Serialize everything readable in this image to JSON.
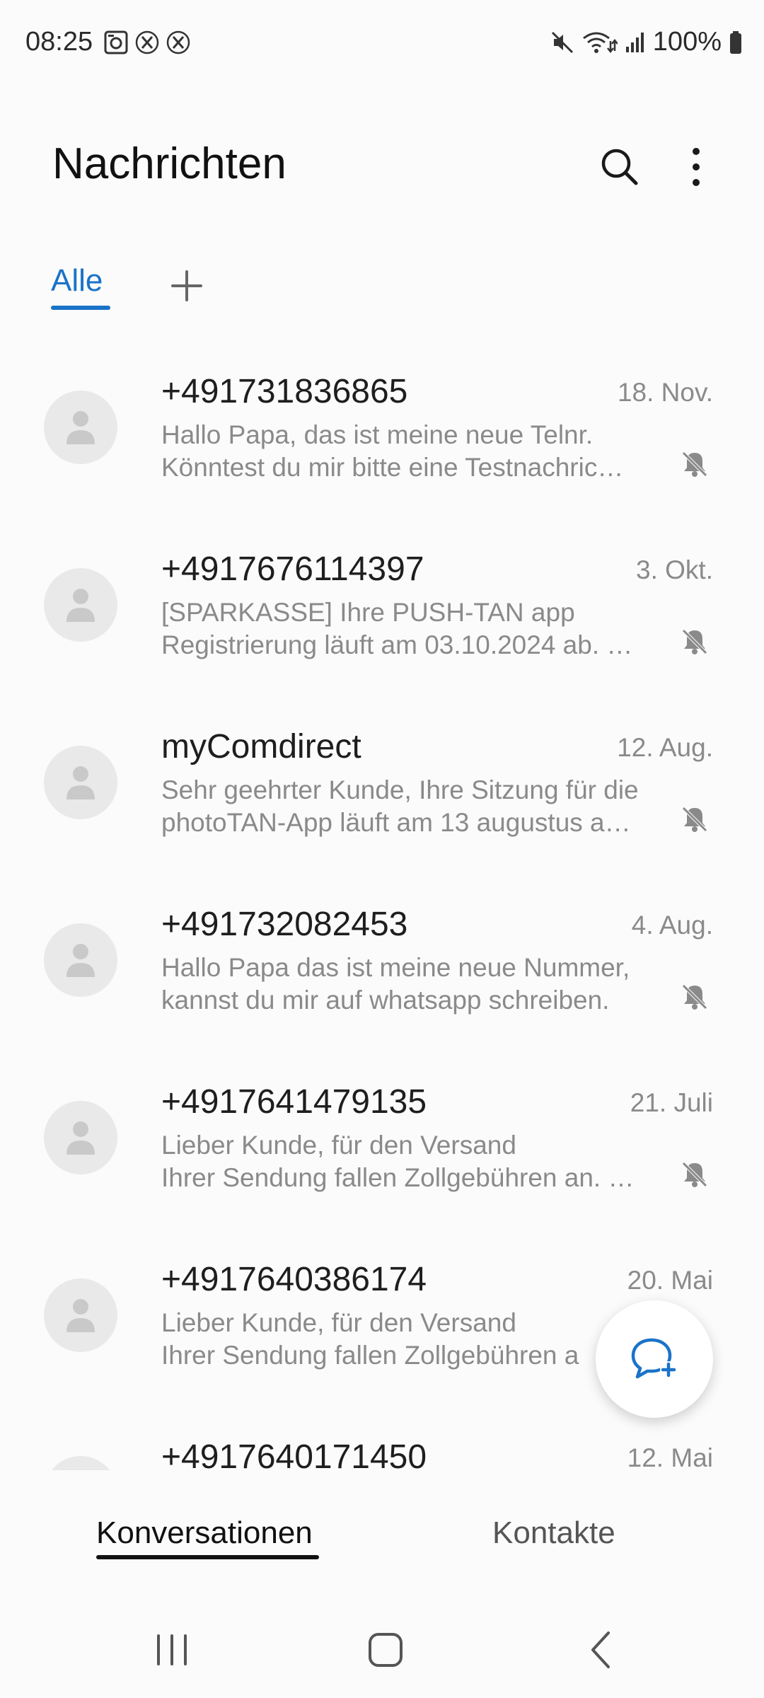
{
  "status_bar": {
    "time": "08:25",
    "left_icons": [
      "gallery-notification-icon",
      "x-notification-icon",
      "x-notification-icon"
    ],
    "right_icons": [
      "mute-icon",
      "wifi-icon",
      "signal-icon",
      "battery-icon"
    ],
    "battery": "100%"
  },
  "header": {
    "title": "Nachrichten",
    "search_icon": "search-icon",
    "more_icon": "more-vertical-icon"
  },
  "categories": {
    "active_label": "Alle",
    "add_icon": "plus-icon",
    "accent_color": "#1a73c8"
  },
  "conversations": [
    {
      "name": "+491731836865",
      "date": "18. Nov.",
      "line1": "Hallo Papa, das ist meine neue Telnr.",
      "line2": "Könntest du mir bitte eine Testnachric…",
      "muted": true
    },
    {
      "name": "+4917676114397",
      "date": "3. Okt.",
      "line1": "[SPARKASSE]  Ihre PUSH-TAN app",
      "line2": "Registrierung läuft am 03.10.2024 ab. …",
      "muted": true
    },
    {
      "name": "myComdirect",
      "date": "12. Aug.",
      "line1": "Sehr geehrter Kunde, Ihre Sitzung für die",
      "line2": "photoTAN-App läuft am 13 augustus a…",
      "muted": true
    },
    {
      "name": "+491732082453",
      "date": "4. Aug.",
      "line1": "Hallo Papa das ist meine neue Nummer,",
      "line2": "kannst du mir auf whatsapp schreiben.",
      "muted": true
    },
    {
      "name": "+4917641479135",
      "date": "21. Juli",
      "line1": "Lieber Kunde, für den Versand",
      "line2": "Ihrer Sendung fallen Zollgebühren an. …",
      "muted": true
    },
    {
      "name": "+4917640386174",
      "date": "20. Mai",
      "line1": "Lieber Kunde, für den Versand",
      "line2": "Ihrer Sendung fallen Zollgebühren a",
      "muted": false
    },
    {
      "name": "+4917640171450",
      "date": "12. Mai",
      "line1": "",
      "line2": "",
      "muted": false
    }
  ],
  "fab": {
    "icon": "new-message-icon"
  },
  "bottom_tabs": {
    "conversations": "Konversationen",
    "contacts": "Kontakte"
  },
  "nav_bar": {
    "recents_icon": "recents-icon",
    "home_icon": "home-icon",
    "back_icon": "back-icon"
  }
}
